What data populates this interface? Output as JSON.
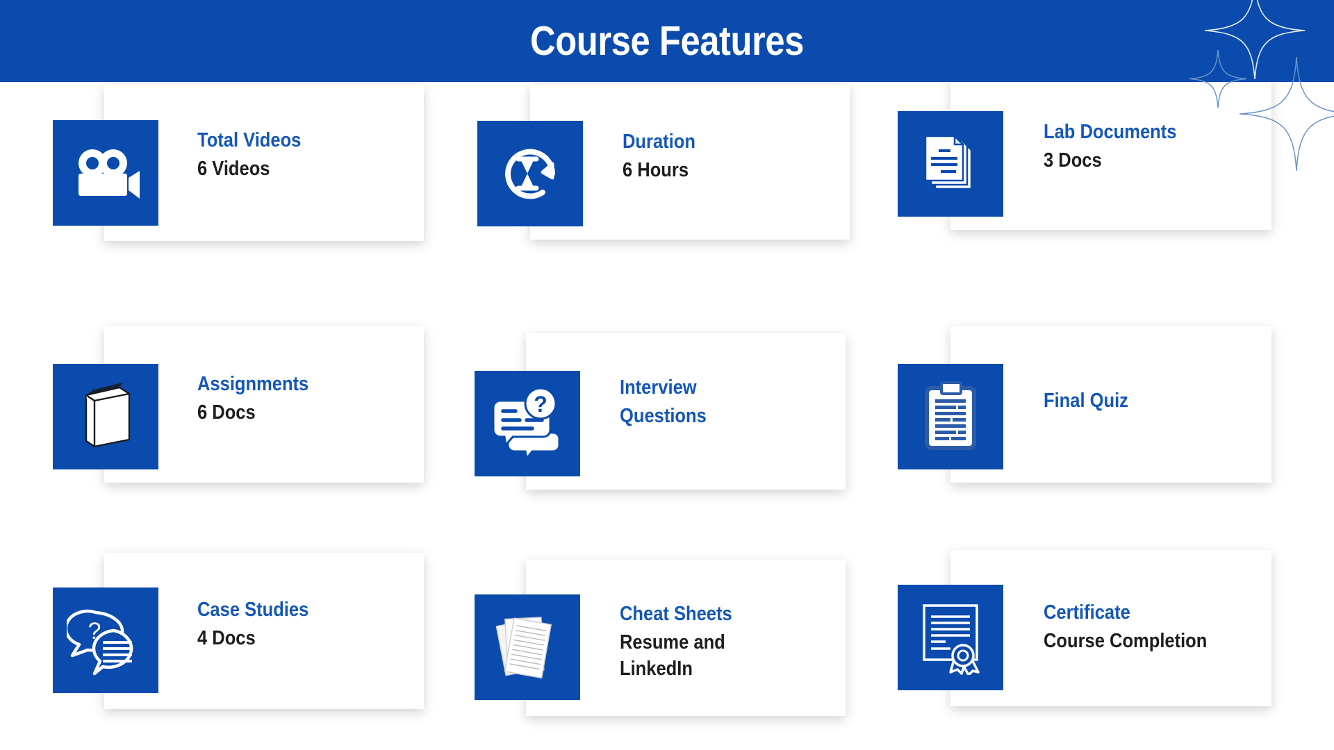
{
  "header": {
    "title": "Course Features",
    "bg_color": "#0a4bad",
    "title_color": "#ffffff"
  },
  "theme": {
    "accent_blue": "#0a4bad",
    "title_blue": "#1457b8",
    "sub_dark": "#1d1d1f",
    "card_bg": "#ffffff",
    "page_bg": "#ffffff"
  },
  "decoration": {
    "sparkle_icon": "four-point-star-icon",
    "sparkle_count": 3
  },
  "features": [
    {
      "title": "Total Videos",
      "subtitle": "6 Videos",
      "icon": "video-camera-icon"
    },
    {
      "title": "Duration",
      "subtitle": "6 Hours",
      "icon": "hourglass-refresh-icon"
    },
    {
      "title": "Lab Documents",
      "subtitle": "3 Docs",
      "icon": "stacked-documents-icon"
    },
    {
      "title": "Assignments",
      "subtitle": "6 Docs",
      "icon": "book-icon"
    },
    {
      "title": "Interview\nQuestions",
      "subtitle": "",
      "icon": "chat-question-icon"
    },
    {
      "title": "Final Quiz",
      "subtitle": "",
      "icon": "clipboard-list-icon"
    },
    {
      "title": "Case Studies",
      "subtitle": "4 Docs",
      "icon": "speech-bubbles-question-icon"
    },
    {
      "title": "Cheat Sheets",
      "subtitle": "Resume and\nLinkedIn",
      "icon": "scattered-papers-icon"
    },
    {
      "title": "Certificate",
      "subtitle": "Course Completion",
      "icon": "certificate-seal-icon"
    }
  ]
}
